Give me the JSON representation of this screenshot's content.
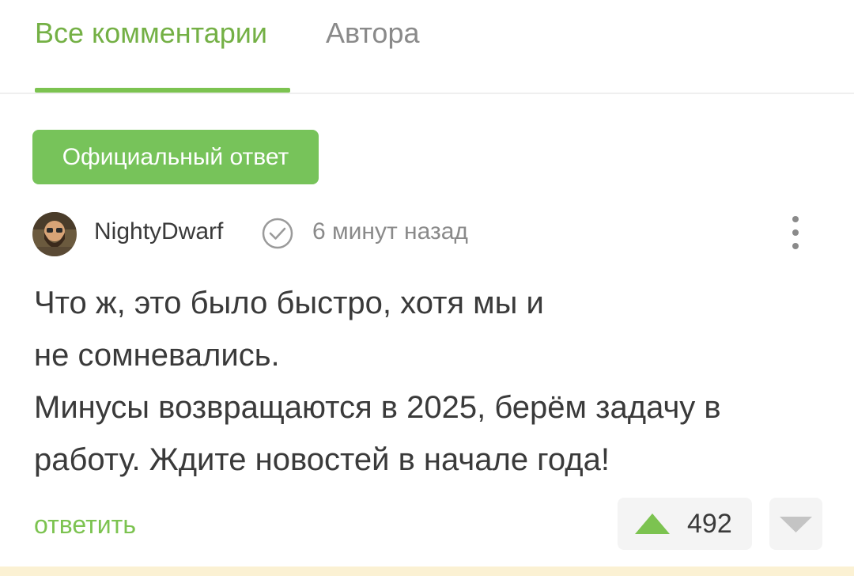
{
  "tabs": [
    {
      "label": "Все комментарии",
      "active": true
    },
    {
      "label": "Автора",
      "active": false
    }
  ],
  "badge": {
    "label": "Официальный ответ",
    "color": "#77c35a"
  },
  "comment": {
    "author": "NightyDwarf",
    "verified_icon": "check-circle-icon",
    "timestamp": "6 минут назад",
    "text_lines": [
      "Что ж, это было быстро, хотя мы и",
      "не сомневались.",
      "Минусы возвращаются в 2025, берём задачу в",
      "работу. Ждите новостей в начале года!"
    ],
    "reply_label": "ответить",
    "rating": "492"
  },
  "colors": {
    "accent": "#7cc350",
    "text": "#3a3a3a",
    "muted": "#8a8a8a"
  }
}
